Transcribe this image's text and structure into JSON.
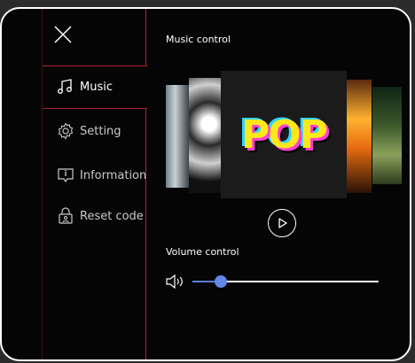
{
  "sidebar": {
    "items": [
      {
        "label": "Music",
        "icon": "music-note-icon"
      },
      {
        "label": "Setting",
        "icon": "gear-icon"
      },
      {
        "label": "Information",
        "icon": "info-icon"
      },
      {
        "label": "Reset code",
        "icon": "lock-icon"
      }
    ]
  },
  "music": {
    "title": "Music control",
    "album_text": "POP",
    "albums": [
      "street-photo-cover",
      "blackwhite-portrait-cover",
      "pop-cover",
      "sunset-cover",
      "forest-cover"
    ]
  },
  "volume": {
    "title": "Volume control",
    "level": 0.15
  },
  "colors": {
    "accent": "#b3202a",
    "slider": "#6387e6"
  }
}
